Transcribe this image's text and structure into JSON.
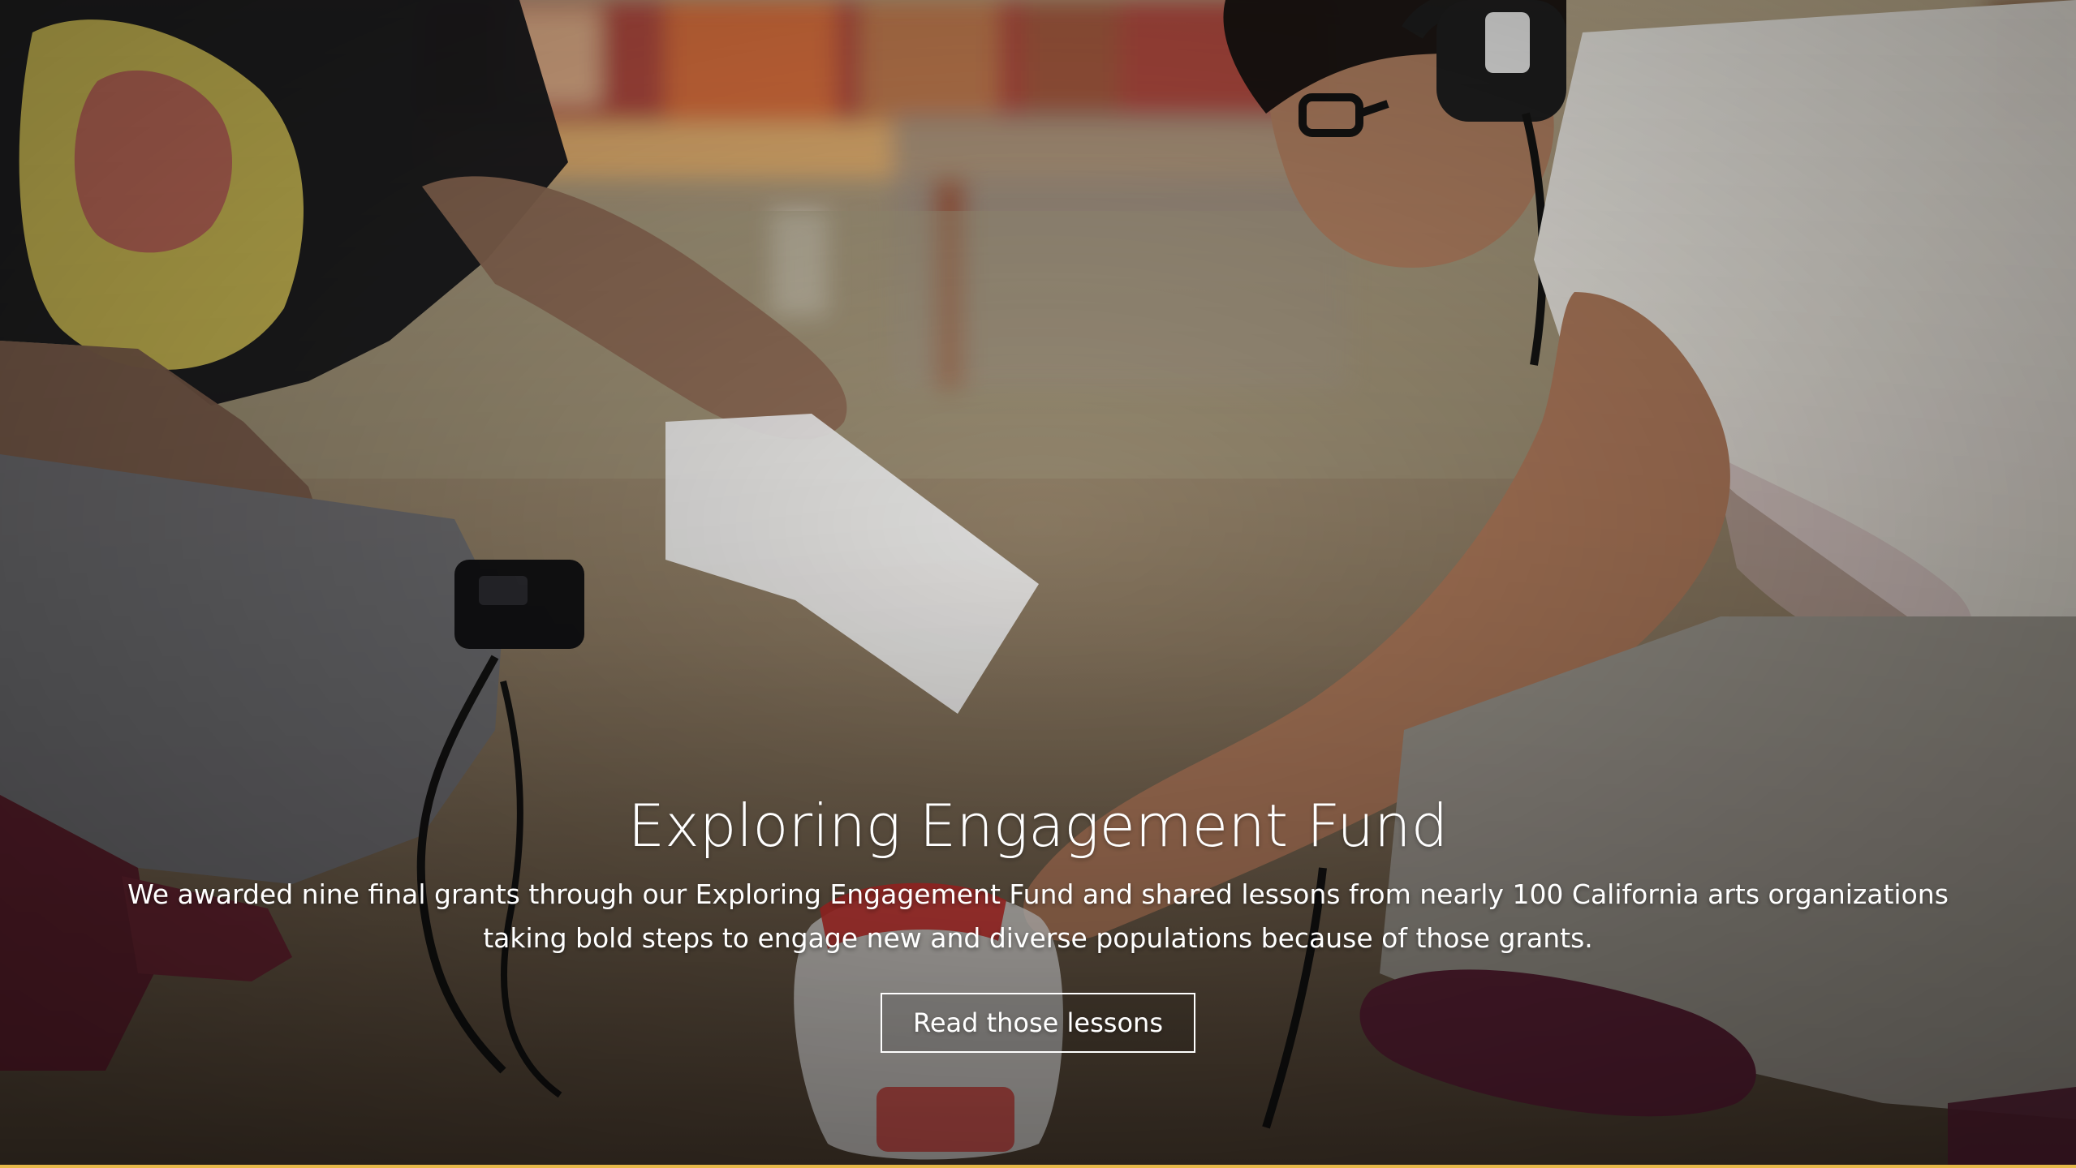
{
  "hero": {
    "title": "Exploring Engagement Fund",
    "description": "We awarded nine final grants through our Exploring Engagement Fund and shared lessons from nearly 100 California arts organizations taking bold steps to engage new and diverse populations because of those grants.",
    "cta_label": "Read those lessons"
  },
  "photo": {
    "semantic": "hero-photo-audio-recording-outdoors"
  },
  "colors": {
    "text": "#ffffff",
    "accent_strip": "#e6b94a"
  }
}
